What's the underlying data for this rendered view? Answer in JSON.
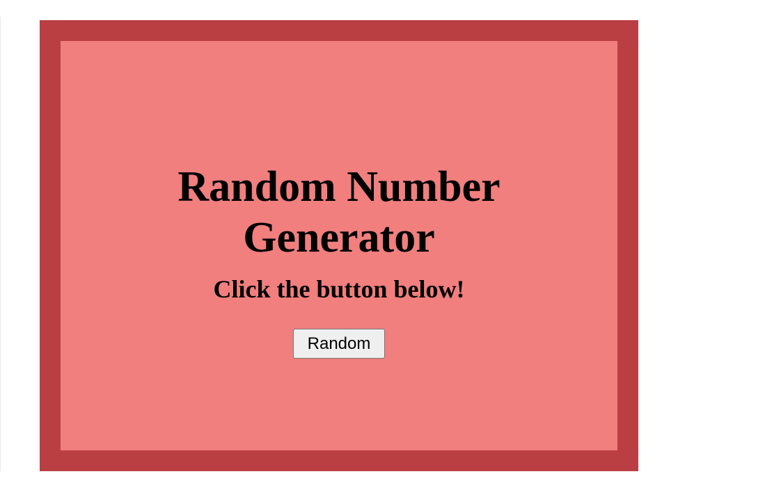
{
  "colors": {
    "frame": "#ba3f43",
    "panel": "#f07f7e",
    "text": "#000000",
    "button_background": "#efefef",
    "button_border": "#767676",
    "page_background": "#ffffff"
  },
  "header": {
    "title_line_1": "Random Number",
    "title_line_2": "Generator"
  },
  "main": {
    "instruction": "Click the button below!",
    "button_label": "Random"
  }
}
